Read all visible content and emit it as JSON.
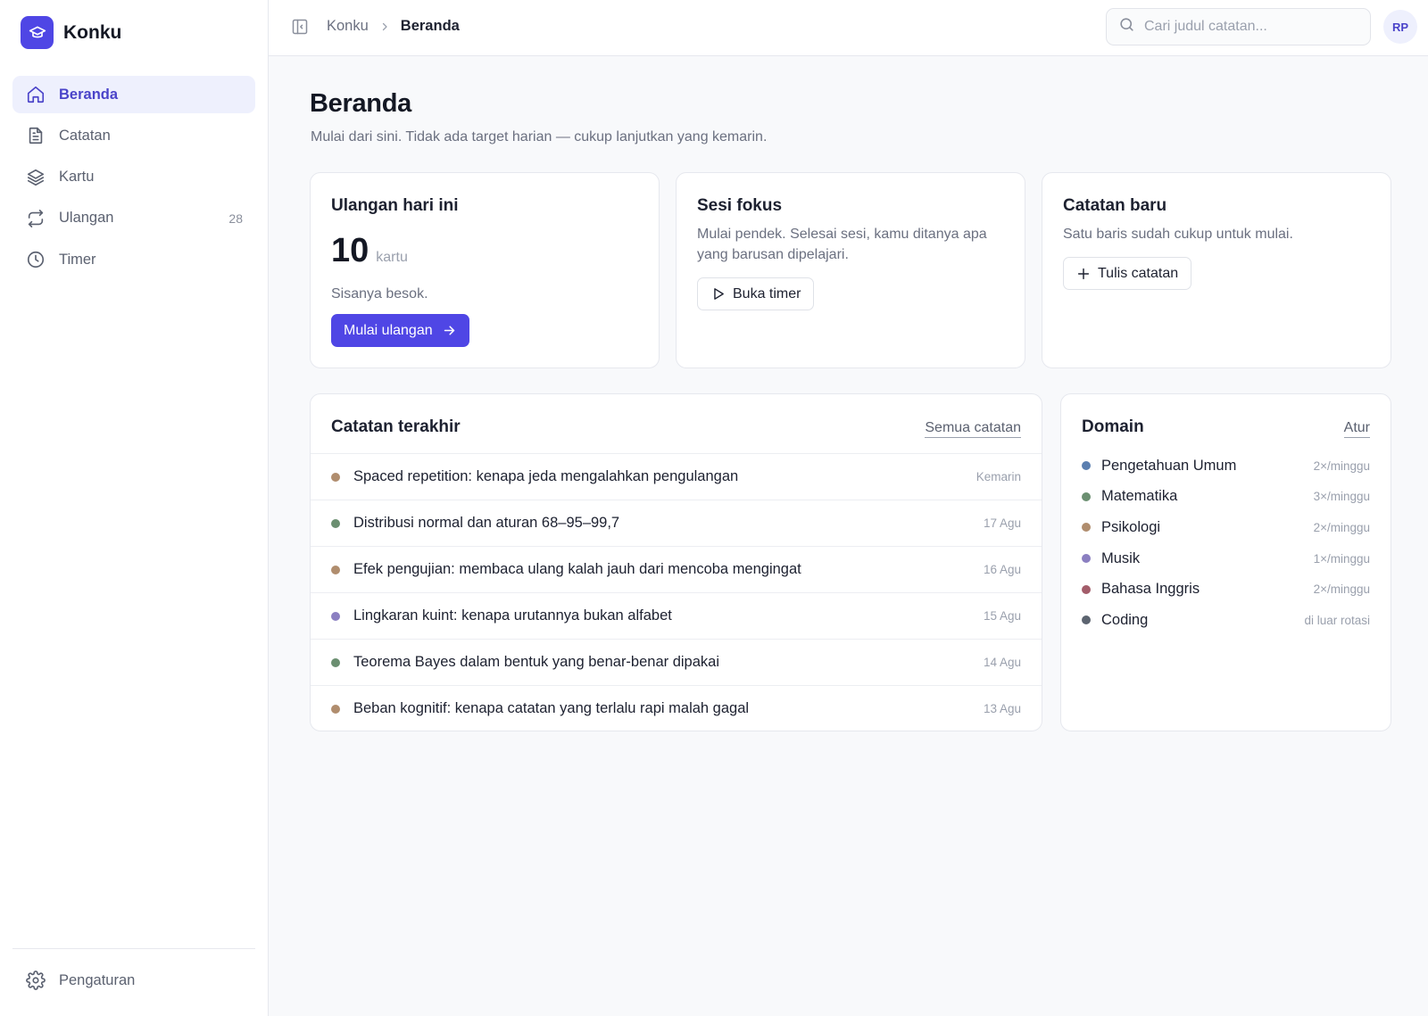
{
  "app": {
    "name": "Konku"
  },
  "sidebar": {
    "items": [
      {
        "label": "Beranda",
        "icon": "home-icon",
        "active": true
      },
      {
        "label": "Catatan",
        "icon": "document-icon"
      },
      {
        "label": "Kartu",
        "icon": "layers-icon"
      },
      {
        "label": "Ulangan",
        "icon": "repeat-icon",
        "count": "28"
      },
      {
        "label": "Timer",
        "icon": "clock-icon"
      }
    ],
    "settings_label": "Pengaturan"
  },
  "topbar": {
    "breadcrumb_root": "Konku",
    "breadcrumb_current": "Beranda",
    "search_placeholder": "Cari judul catatan...",
    "avatar_initials": "RP"
  },
  "page": {
    "title": "Beranda",
    "subtitle": "Mulai dari sini. Tidak ada target harian — cukup lanjutkan yang kemarin."
  },
  "cards": {
    "review": {
      "title": "Ulangan hari ini",
      "count": "10",
      "unit": "kartu",
      "note": "Sisanya besok.",
      "button": "Mulai ulangan"
    },
    "focus": {
      "title": "Sesi fokus",
      "desc": "Mulai pendek. Selesai sesi, kamu ditanya apa yang barusan dipelajari.",
      "button": "Buka timer"
    },
    "new_note": {
      "title": "Catatan baru",
      "desc": "Satu baris sudah cukup untuk mulai.",
      "button": "Tulis catatan"
    }
  },
  "recent_notes": {
    "title": "Catatan terakhir",
    "link": "Semua catatan",
    "items": [
      {
        "title": "Spaced repetition: kenapa jeda mengalahkan pengulangan",
        "date": "Kemarin",
        "color": "#b08d6e"
      },
      {
        "title": "Distribusi normal dan aturan 68–95–99,7",
        "date": "17 Agu",
        "color": "#6b8f71"
      },
      {
        "title": "Efek pengujian: membaca ulang kalah jauh dari mencoba mengingat",
        "date": "16 Agu",
        "color": "#b08d6e"
      },
      {
        "title": "Lingkaran kuint: kenapa urutannya bukan alfabet",
        "date": "15 Agu",
        "color": "#8b7fc1"
      },
      {
        "title": "Teorema Bayes dalam bentuk yang benar-benar dipakai",
        "date": "14 Agu",
        "color": "#6b8f71"
      },
      {
        "title": "Beban kognitif: kenapa catatan yang terlalu rapi malah gagal",
        "date": "13 Agu",
        "color": "#b08d6e"
      }
    ]
  },
  "domains": {
    "title": "Domain",
    "link": "Atur",
    "items": [
      {
        "name": "Pengetahuan Umum",
        "freq": "2×/minggu",
        "color": "#5b7fb0"
      },
      {
        "name": "Matematika",
        "freq": "3×/minggu",
        "color": "#6b8f71"
      },
      {
        "name": "Psikologi",
        "freq": "2×/minggu",
        "color": "#b08d6e"
      },
      {
        "name": "Musik",
        "freq": "1×/minggu",
        "color": "#8b7fc1"
      },
      {
        "name": "Bahasa Inggris",
        "freq": "2×/minggu",
        "color": "#a35d6a"
      },
      {
        "name": "Coding",
        "freq": "di luar rotasi",
        "color": "#5c6470"
      }
    ]
  },
  "colors": {
    "accent": "#4f46e5",
    "accent_soft": "#eef0fd"
  }
}
